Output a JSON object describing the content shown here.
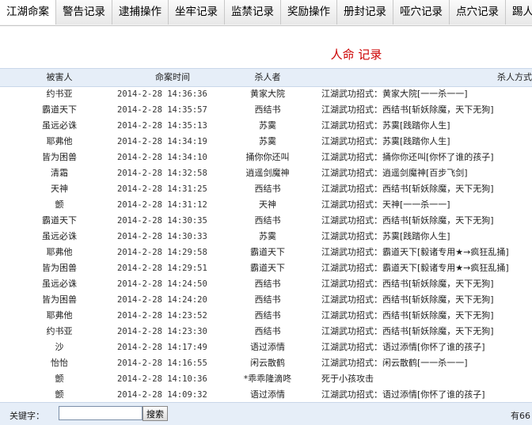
{
  "nav": {
    "tabs": [
      {
        "label": "江湖命案"
      },
      {
        "label": "警告记录"
      },
      {
        "label": "逮捕操作"
      },
      {
        "label": "坐牢记录"
      },
      {
        "label": "监禁记录"
      },
      {
        "label": "奖励操作"
      },
      {
        "label": "册封记录"
      },
      {
        "label": "哑穴记录"
      },
      {
        "label": "点穴记录"
      },
      {
        "label": "踢人"
      }
    ]
  },
  "title": "人命 记录",
  "table": {
    "headers": {
      "victim": "被害人",
      "time": "命案时间",
      "killer": "杀人者",
      "method": "杀人方式"
    },
    "rows": [
      {
        "victim": "约书亚",
        "time": "2014-2-28 14:36:36",
        "killer": "黄家大院",
        "method": "江湖武功招式：黄家大院[一一杀一一]"
      },
      {
        "victim": "霸道天下",
        "time": "2014-2-28 14:35:57",
        "killer": "西结书",
        "method": "江湖武功招式：西结书[斩妖除魔，天下无狗]"
      },
      {
        "victim": "虽远必诛",
        "time": "2014-2-28 14:35:13",
        "killer": "苏霙",
        "method": "江湖武功招式：苏霙[践踏你人生]"
      },
      {
        "victim": "耶弗他",
        "time": "2014-2-28 14:34:19",
        "killer": "苏霙",
        "method": "江湖武功招式：苏霙[践踏你人生]"
      },
      {
        "victim": "皆为困兽",
        "time": "2014-2-28 14:34:10",
        "killer": "捅你你还叫",
        "method": "江湖武功招式：捅你你还叫[你怀了谁的孩子]"
      },
      {
        "victim": "清霜",
        "time": "2014-2-28 14:32:58",
        "killer": "逍遥剑魔神",
        "method": "江湖武功招式：逍遥剑魔神[百步飞剑]"
      },
      {
        "victim": "天神",
        "time": "2014-2-28 14:31:25",
        "killer": "西结书",
        "method": "江湖武功招式：西结书[斩妖除魔，天下无狗]"
      },
      {
        "victim": "颤",
        "time": "2014-2-28 14:31:12",
        "killer": "天神",
        "method": "江湖武功招式：天神[一一杀一一]"
      },
      {
        "victim": "霸道天下",
        "time": "2014-2-28 14:30:35",
        "killer": "西结书",
        "method": "江湖武功招式：西结书[斩妖除魔，天下无狗]"
      },
      {
        "victim": "虽远必诛",
        "time": "2014-2-28 14:30:33",
        "killer": "苏霙",
        "method": "江湖武功招式：苏霙[践踏你人生]"
      },
      {
        "victim": "耶弗他",
        "time": "2014-2-28 14:29:58",
        "killer": "霸道天下",
        "method": "江湖武功招式：霸道天下[毅诸专用★→疯狂乱捅]"
      },
      {
        "victim": "皆为困兽",
        "time": "2014-2-28 14:29:51",
        "killer": "霸道天下",
        "method": "江湖武功招式：霸道天下[毅诸专用★→疯狂乱捅]"
      },
      {
        "victim": "虽远必诛",
        "time": "2014-2-28 14:24:50",
        "killer": "西结书",
        "method": "江湖武功招式：西结书[斩妖除魔，天下无狗]"
      },
      {
        "victim": "皆为困兽",
        "time": "2014-2-28 14:24:20",
        "killer": "西结书",
        "method": "江湖武功招式：西结书[斩妖除魔，天下无狗]"
      },
      {
        "victim": "耶弗他",
        "time": "2014-2-28 14:23:52",
        "killer": "西结书",
        "method": "江湖武功招式：西结书[斩妖除魔，天下无狗]"
      },
      {
        "victim": "约书亚",
        "time": "2014-2-28 14:23:30",
        "killer": "西结书",
        "method": "江湖武功招式：西结书[斩妖除魔，天下无狗]"
      },
      {
        "victim": "沙",
        "time": "2014-2-28 14:17:49",
        "killer": "语过添情",
        "method": "江湖武功招式：语过添情[你怀了谁的孩子]"
      },
      {
        "victim": "怡怡",
        "time": "2014-2-28 14:16:55",
        "killer": "闲云散鹤",
        "method": "江湖武功招式：闲云散鹤[一一杀一一]"
      },
      {
        "victim": "颤",
        "time": "2014-2-28 14:10:36",
        "killer": "*乖乖隆滴咚",
        "method": "死于小孩攻击"
      },
      {
        "victim": "颤",
        "time": "2014-2-28 14:09:32",
        "killer": "语过添情",
        "method": "江湖武功招式：语过添情[你怀了谁的孩子]"
      }
    ]
  },
  "search": {
    "label": "关键字：",
    "value": "",
    "button_label": "搜索"
  },
  "footer": {
    "count_text": "有66"
  }
}
